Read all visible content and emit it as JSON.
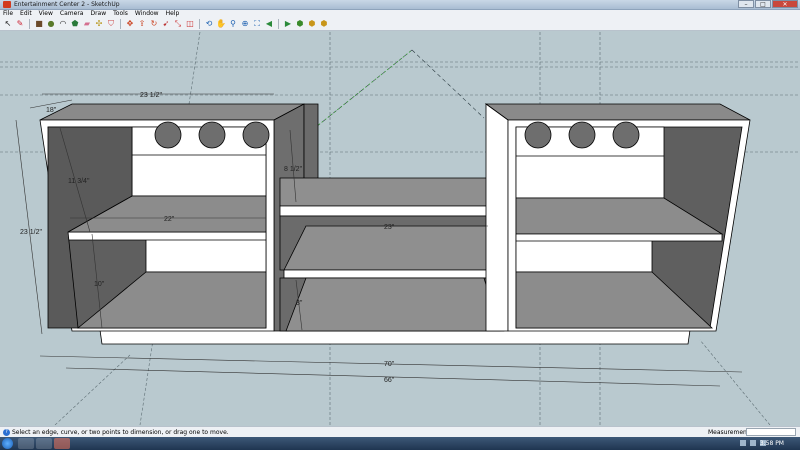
{
  "window": {
    "title": "Entertainment Center 2 - SketchUp"
  },
  "menu": [
    "File",
    "Edit",
    "View",
    "Camera",
    "Draw",
    "Tools",
    "Window",
    "Help"
  ],
  "toolbar": {
    "tools": [
      {
        "name": "select-icon",
        "glyph": "↖",
        "color": "#222"
      },
      {
        "name": "pencil-icon",
        "glyph": "✎",
        "color": "#c23"
      },
      {
        "name": "rectangle-icon",
        "glyph": "■",
        "color": "#6b4a2a"
      },
      {
        "name": "circle-icon",
        "glyph": "●",
        "color": "#5a7a2a"
      },
      {
        "name": "arc-icon",
        "glyph": "◠",
        "color": "#333"
      },
      {
        "name": "polygon-icon",
        "glyph": "⬟",
        "color": "#2a7a3a"
      },
      {
        "name": "eraser-icon",
        "glyph": "▰",
        "color": "#d47090"
      },
      {
        "name": "tape-measure-icon",
        "glyph": "✣",
        "color": "#b8961a"
      },
      {
        "name": "paint-bucket-icon",
        "glyph": "⛉",
        "color": "#c44"
      },
      {
        "name": "move-icon",
        "glyph": "✥",
        "color": "#c42"
      },
      {
        "name": "push-pull-icon",
        "glyph": "⇪",
        "color": "#c42"
      },
      {
        "name": "rotate-icon",
        "glyph": "↻",
        "color": "#c42"
      },
      {
        "name": "follow-me-icon",
        "glyph": "➹",
        "color": "#b33"
      },
      {
        "name": "scale-icon",
        "glyph": "⤡",
        "color": "#c33"
      },
      {
        "name": "offset-icon",
        "glyph": "◫",
        "color": "#c33"
      },
      {
        "name": "orbit-icon",
        "glyph": "⟲",
        "color": "#1a5fb0"
      },
      {
        "name": "pan-icon",
        "glyph": "✋",
        "color": "#1a5fb0"
      },
      {
        "name": "zoom-icon",
        "glyph": "⚲",
        "color": "#1a5fb0"
      },
      {
        "name": "zoom-window-icon",
        "glyph": "⊕",
        "color": "#1a5fb0"
      },
      {
        "name": "zoom-extents-icon",
        "glyph": "⛶",
        "color": "#1a5fb0"
      },
      {
        "name": "previous-view-icon",
        "glyph": "◀",
        "color": "#2a8a3a"
      },
      {
        "name": "next-view-icon",
        "glyph": "▶",
        "color": "#2a8a3a"
      },
      {
        "name": "get-models-icon",
        "glyph": "⬢",
        "color": "#3a8a2a"
      },
      {
        "name": "share-model-icon",
        "glyph": "⬢",
        "color": "#c8961a"
      },
      {
        "name": "components-icon",
        "glyph": "⬢",
        "color": "#c8961a"
      }
    ]
  },
  "dimensions": {
    "top_width": "23 1/2\"",
    "depth": "18\"",
    "height": "23 1/2\"",
    "upper_height": "11 3/4\"",
    "lower_height": "10\"",
    "shelf_width": "22\"",
    "center_shelf_width": "23\"",
    "center_upper": "8 1/2\"",
    "center_lower": "8\"",
    "overall": "70\"",
    "base": "66\""
  },
  "status": {
    "hint": "Select an edge, curve, or two points to dimension, or drag one to move.",
    "measurements_label": "Measurements",
    "measurements_value": ""
  },
  "taskbar": {
    "time": "3:58 PM"
  },
  "colors": {
    "viewport_bg": "#b9c9cf",
    "panel_white": "#ffffff",
    "inner_dark": "#6b6b6b",
    "shelf_gray": "#8e8e8e",
    "edge": "#000000",
    "guide": "#4a5a60",
    "axis_green": "#3c9a3c"
  }
}
